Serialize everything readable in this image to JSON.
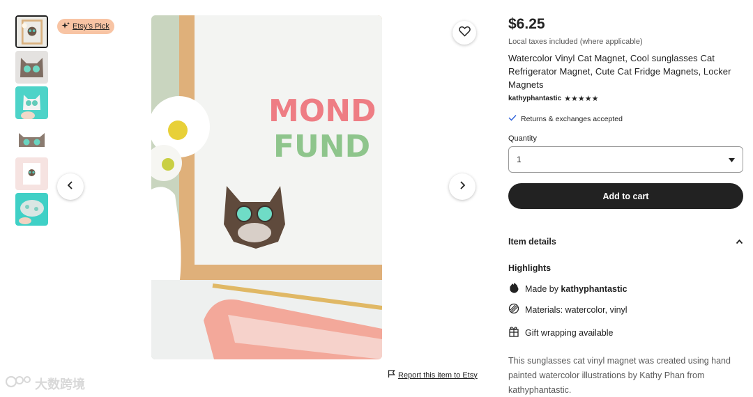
{
  "badge": {
    "label": "Etsy's Pick",
    "icon": "sparkle-icon"
  },
  "gallery": {
    "thumbnail_count": 6,
    "active_index": 0,
    "image_text": [
      "MOND",
      "FUND"
    ]
  },
  "report": {
    "label": "Report this item to Etsy",
    "icon": "flag-icon"
  },
  "watermark": {
    "text": "大数跨境"
  },
  "product": {
    "price": "$6.25",
    "tax_note": "Local taxes included (where applicable)",
    "title": "Watercolor Vinyl Cat Magnet, Cool sunglasses Cat Refrigerator Magnet, Cute Cat Fridge Magnets, Locker Magnets",
    "seller": "kathyphantastic",
    "rating_stars": "★★★★★",
    "rating": 5,
    "returns": "Returns & exchanges accepted"
  },
  "quantity": {
    "label": "Quantity",
    "value": "1"
  },
  "cart": {
    "label": "Add to cart"
  },
  "details": {
    "heading": "Item details",
    "highlights_heading": "Highlights",
    "made_by_prefix": "Made by ",
    "made_by_seller": "kathyphantastic",
    "materials": "Materials: watercolor, vinyl",
    "gift": "Gift wrapping available",
    "description": "This sunglasses cat vinyl magnet was created using hand painted watercolor illustrations by Kathy Phan from kathyphantastic."
  },
  "colors": {
    "badge": "#f8c4a4",
    "button": "#222222",
    "accent_mint": "#5ad6cc"
  }
}
